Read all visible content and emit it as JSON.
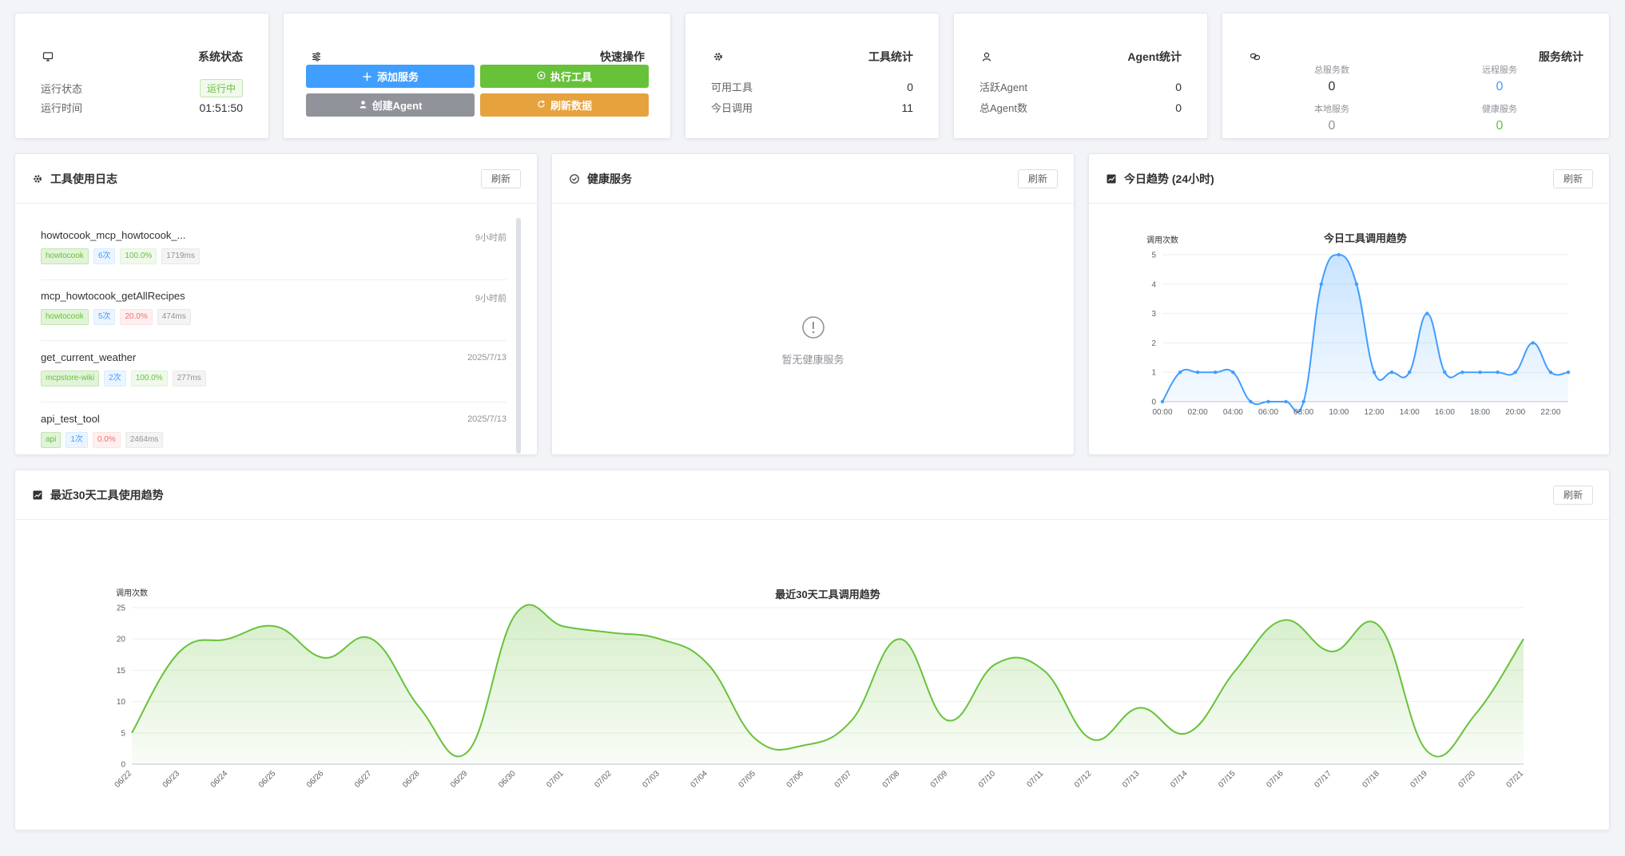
{
  "system_status": {
    "title": "系统状态",
    "icon": "monitor-icon",
    "run_state_label": "运行状态",
    "run_state_value": "运行中",
    "uptime_label": "运行时间",
    "uptime_value": "01:51:50"
  },
  "quick_actions": {
    "title": "快速操作",
    "icon": "sliders-icon",
    "add_service": "添加服务",
    "run_tool": "执行工具",
    "create_agent": "创建Agent",
    "refresh_data": "刷新数据",
    "colors": {
      "add": "#409eff",
      "run": "#67c23a",
      "create": "#909399",
      "refresh": "#e6a23c"
    }
  },
  "tool_stats": {
    "title": "工具统计",
    "icon": "gear-icon",
    "available_label": "可用工具",
    "available_value": "0",
    "today_calls_label": "今日调用",
    "today_calls_value": "11"
  },
  "agent_stats": {
    "title": "Agent统计",
    "icon": "user-icon",
    "active_label": "活跃Agent",
    "active_value": "0",
    "total_label": "总Agent数",
    "total_value": "0"
  },
  "service_stats": {
    "title": "服务统计",
    "icon": "link-icon",
    "total_label": "总服务数",
    "total_value": "0",
    "remote_label": "远程服务",
    "remote_value": "0",
    "local_label": "本地服务",
    "local_value": "0",
    "healthy_label": "健康服务",
    "healthy_value": "0"
  },
  "tool_log": {
    "title": "工具使用日志",
    "refresh_label": "刷新",
    "items": [
      {
        "name": "howtocook_mcp_howtocook_...",
        "time": "9小时前",
        "service": "howtocook",
        "calls": "6次",
        "rate": "100.0%",
        "duration": "1719ms",
        "rate_ok": true
      },
      {
        "name": "mcp_howtocook_getAllRecipes",
        "time": "9小时前",
        "service": "howtocook",
        "calls": "5次",
        "rate": "20.0%",
        "duration": "474ms",
        "rate_ok": false
      },
      {
        "name": "get_current_weather",
        "time": "2025/7/13",
        "service": "mcpstore-wiki",
        "calls": "2次",
        "rate": "100.0%",
        "duration": "277ms",
        "rate_ok": true
      },
      {
        "name": "api_test_tool",
        "time": "2025/7/13",
        "service": "api",
        "calls": "1次",
        "rate": "0.0%",
        "duration": "2464ms",
        "rate_ok": false
      }
    ]
  },
  "healthy_services": {
    "title": "健康服务",
    "refresh_label": "刷新",
    "empty_text": "暂无健康服务"
  },
  "today_trend": {
    "title": "今日趋势 (24小时)",
    "refresh_label": "刷新"
  },
  "month_trend": {
    "title": "最近30天工具使用趋势",
    "refresh_label": "刷新"
  },
  "chart_data": [
    {
      "type": "area",
      "title": "今日工具调用趋势",
      "ylabel": "调用次数",
      "xlabel": "",
      "ylim": [
        0,
        5
      ],
      "yticks": [
        0,
        1,
        2,
        3,
        4,
        5
      ],
      "xtick_labels": [
        "00:00",
        "02:00",
        "04:00",
        "06:00",
        "08:00",
        "10:00",
        "12:00",
        "14:00",
        "16:00",
        "18:00",
        "20:00",
        "22:00"
      ],
      "x": [
        "00:00",
        "01:00",
        "02:00",
        "03:00",
        "04:00",
        "05:00",
        "06:00",
        "07:00",
        "08:00",
        "09:00",
        "10:00",
        "11:00",
        "12:00",
        "13:00",
        "14:00",
        "15:00",
        "16:00",
        "17:00",
        "18:00",
        "19:00",
        "20:00",
        "21:00",
        "22:00",
        "23:00"
      ],
      "values": [
        0,
        1,
        1,
        1,
        1,
        0,
        0,
        0,
        0,
        4,
        5,
        4,
        1,
        1,
        1,
        3,
        1,
        1,
        1,
        1,
        1,
        2,
        1,
        1
      ],
      "color": "#409eff",
      "grid": true,
      "legend": "none"
    },
    {
      "type": "area",
      "title": "最近30天工具调用趋势",
      "ylabel": "调用次数",
      "xlabel": "",
      "ylim": [
        0,
        25
      ],
      "yticks": [
        0,
        5,
        10,
        15,
        20,
        25
      ],
      "x": [
        "06/22",
        "06/23",
        "06/24",
        "06/25",
        "06/26",
        "06/27",
        "06/28",
        "06/29",
        "06/30",
        "07/01",
        "07/02",
        "07/03",
        "07/04",
        "07/05",
        "07/06",
        "07/07",
        "07/08",
        "07/09",
        "07/10",
        "07/11",
        "07/12",
        "07/13",
        "07/14",
        "07/15",
        "07/16",
        "07/17",
        "07/18",
        "07/19",
        "07/20",
        "07/21"
      ],
      "values": [
        5,
        18,
        20,
        22,
        17,
        20,
        9,
        2,
        24,
        22,
        21,
        20,
        16,
        4,
        3,
        7,
        20,
        7,
        16,
        15,
        4,
        9,
        5,
        15,
        23,
        18,
        22,
        2,
        8,
        20
      ],
      "color": "#67c23a",
      "grid": true,
      "legend": "none"
    }
  ]
}
